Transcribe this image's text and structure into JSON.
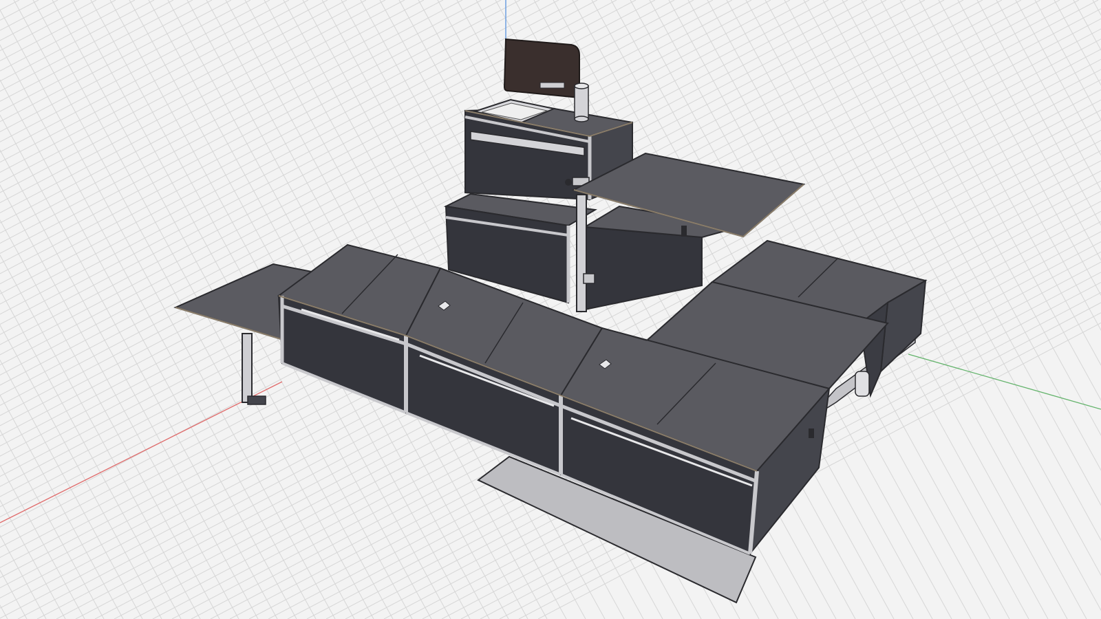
{
  "viewport": {
    "view": "3D perspective",
    "background_color": "#f3f3f3",
    "grid": true,
    "grid_color": "#d6d6d6",
    "axes": {
      "x_color": "#e06b6b",
      "y_color": "#63b36b",
      "z_color": "#6d9fe0"
    }
  },
  "model": {
    "panel_top_color": "#5a5a60",
    "panel_front_color": "#34353c",
    "panel_side_color": "#44454c",
    "frame_color": "#c8c8cc",
    "base_plate_color": "#b9b9bd",
    "lid_color": "#3a2f2d",
    "parts": [
      "left-fold-table",
      "left-table-leg",
      "front-cabinet-1",
      "front-cabinet-2",
      "front-cabinet-3",
      "right-cabinet",
      "rear-cabinet",
      "tall-cabinet",
      "sink",
      "sink-lid",
      "faucet-cylinder",
      "upper-fold-table",
      "upper-table-post",
      "base-plate"
    ]
  }
}
